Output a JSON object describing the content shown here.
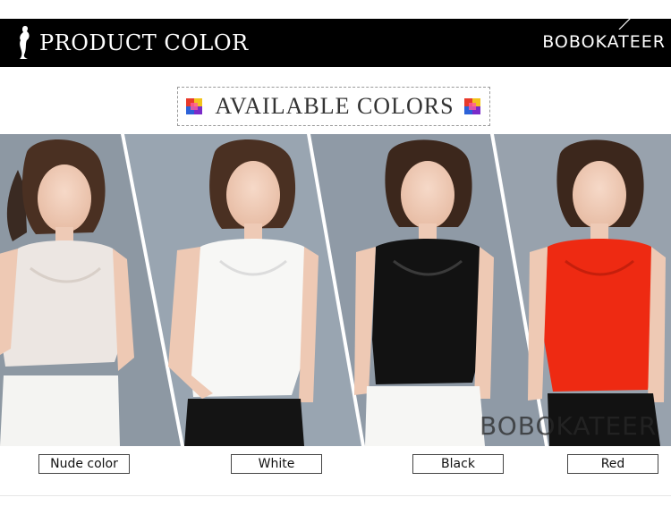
{
  "header": {
    "title": "PRODUCT COLOR",
    "brand": "BOBOKATEER"
  },
  "section": {
    "title": "AVAILABLE COLORS"
  },
  "watermark": "BOBOKATEER",
  "variants": [
    {
      "label": "Nude color",
      "top_color": "#ece6e2",
      "bottom_color": "#f4f4f2",
      "bg_color": "#8d98a3"
    },
    {
      "label": "White",
      "top_color": "#f7f7f5",
      "bottom_color": "#141414",
      "bg_color": "#99a5b1"
    },
    {
      "label": "Black",
      "top_color": "#121212",
      "bottom_color": "#f6f6f4",
      "bg_color": "#8f9aa6"
    },
    {
      "label": "Red",
      "top_color": "#ee2a12",
      "bottom_color": "#121212",
      "bg_color": "#98a2ad"
    }
  ],
  "colors": {
    "header_bg": "#000000",
    "header_text": "#ffffff",
    "panel_gap": "#ffffff"
  }
}
